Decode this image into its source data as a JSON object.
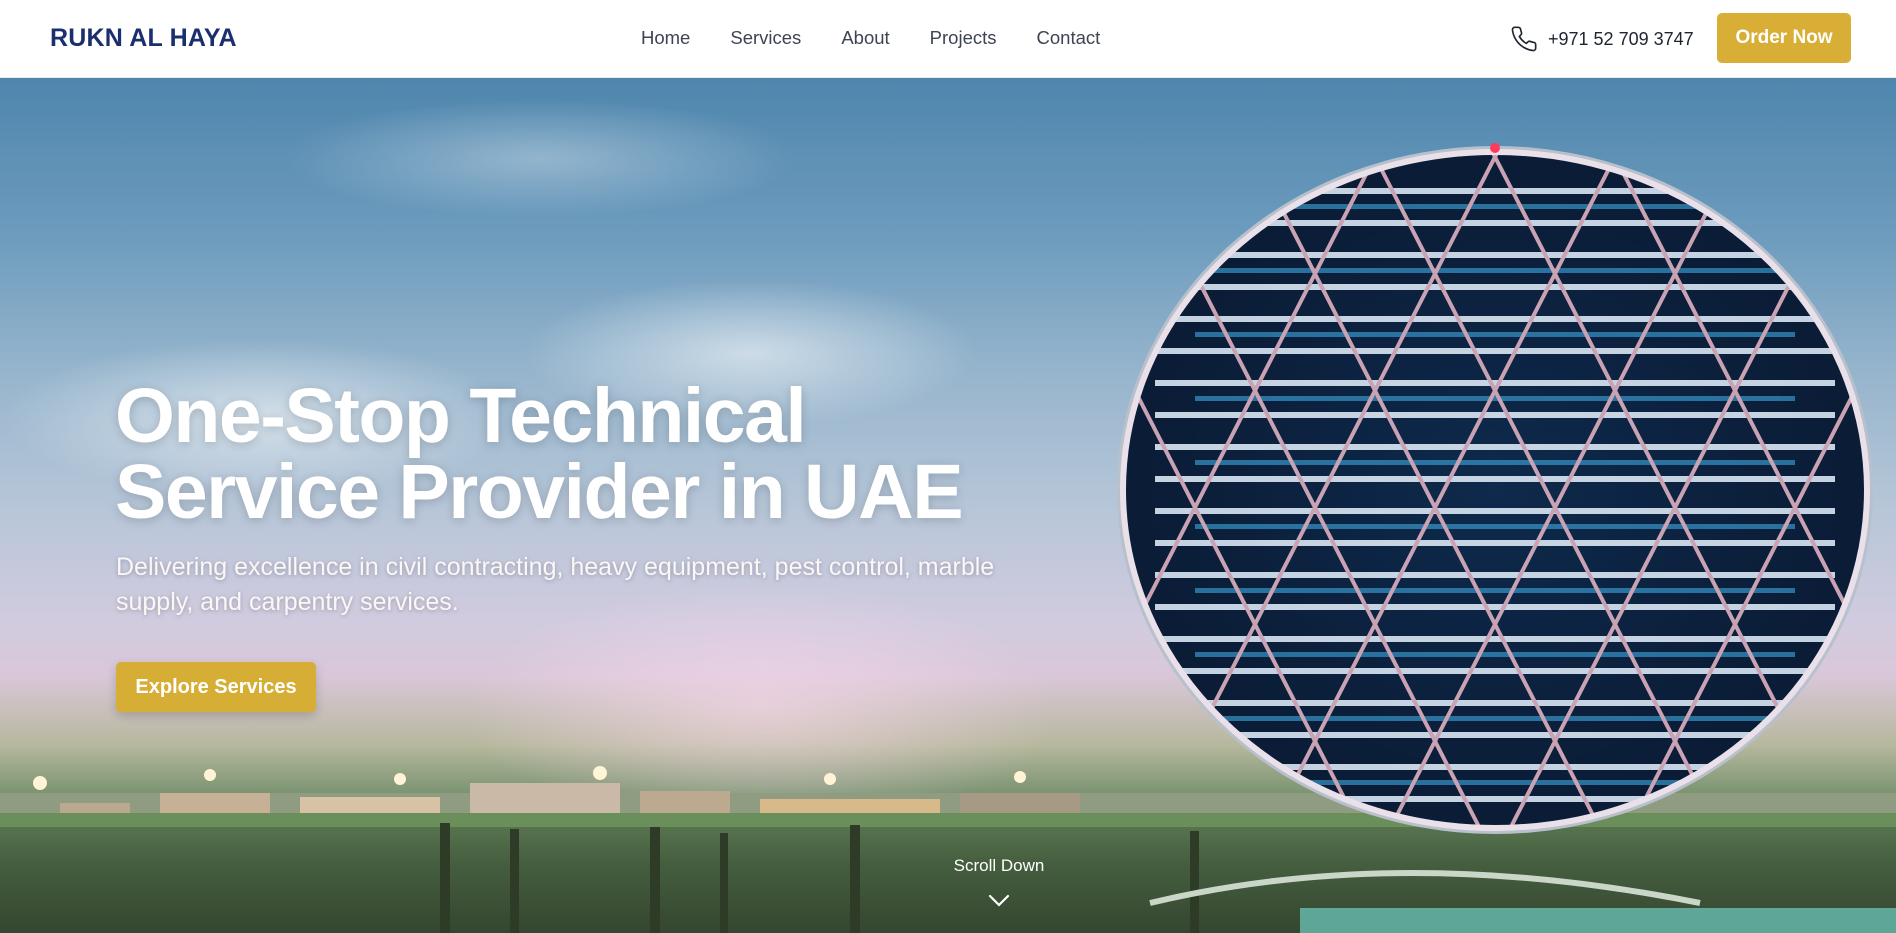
{
  "header": {
    "logo": "RUKN AL HAYA",
    "nav": [
      {
        "label": "Home"
      },
      {
        "label": "Services"
      },
      {
        "label": "About"
      },
      {
        "label": "Projects"
      },
      {
        "label": "Contact"
      }
    ],
    "phone": {
      "icon": "phone-icon",
      "number": "+971 52 709 3747"
    },
    "order_label": "Order Now"
  },
  "hero": {
    "title_line1": "One-Stop Technical",
    "title_line2": "Service Provider in UAE",
    "subtitle": "Delivering excellence in civil contracting, heavy equipment, pest control, marble supply, and carpentry services.",
    "cta_label": "Explore Services",
    "scroll_label": "Scroll Down",
    "scroll_icon": "chevron-down-icon"
  },
  "colors": {
    "brand_navy": "#1b2f6e",
    "accent_gold": "#d9ae36",
    "nav_text": "#3d4452"
  }
}
